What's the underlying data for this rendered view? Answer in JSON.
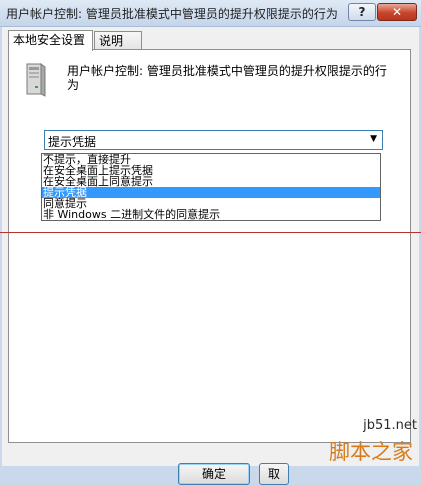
{
  "window": {
    "title": "用户帐户控制: 管理员批准模式中管理员的提升权限提示的行为",
    "help_label": "?",
    "close_label": "✕"
  },
  "tabs": [
    {
      "label": "本地安全设置",
      "active": true
    },
    {
      "label": "说明",
      "active": false
    }
  ],
  "policy": {
    "icon": "server-icon",
    "title": "用户帐户控制: 管理员批准模式中管理员的提升权限提示的行为"
  },
  "combo": {
    "value": "提示凭据",
    "arrow": "▼"
  },
  "dropdown": {
    "options": [
      "不提示，直接提升",
      "在安全桌面上提示凭据",
      "在安全桌面上同意提示",
      "提示凭据",
      "同意提示",
      "非 Windows 二进制文件的同意提示"
    ],
    "selected_index": 3
  },
  "buttons": {
    "ok_label": "确定",
    "cancel_label": "取"
  },
  "watermark": {
    "url": "jb51.net",
    "name": "脚本之家"
  },
  "colors": {
    "selection": "#3399ff",
    "close_red": "#c9442c",
    "focus_border": "#3c7fb1"
  }
}
